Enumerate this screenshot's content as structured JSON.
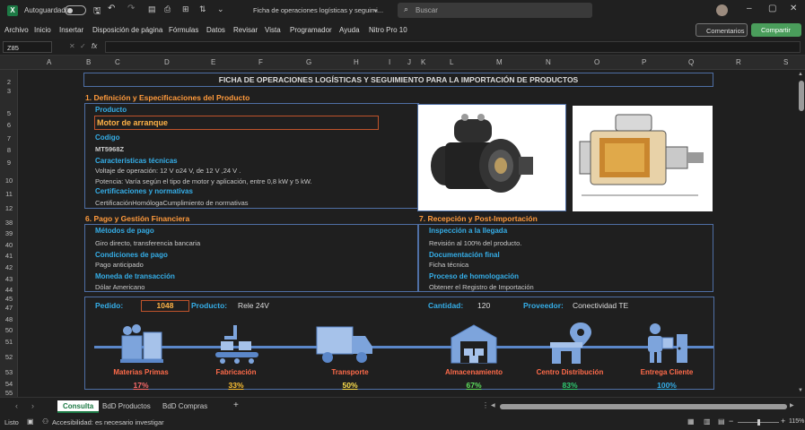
{
  "titlebar": {
    "app_icon": "excel-icon",
    "autosave_label": "Autoguardado",
    "doc_title": "Ficha de operaciones logísticas y seguimi...",
    "search_placeholder": "Buscar"
  },
  "menu": [
    "Archivo",
    "Inicio",
    "Insertar",
    "Disposición de página",
    "Fórmulas",
    "Datos",
    "Revisar",
    "Vista",
    "Programador",
    "Ayuda",
    "Nitro Pro 10"
  ],
  "comments_label": "Comentarios",
  "share_label": "Compartir",
  "formula": {
    "cell_ref": "Z85",
    "fx": "fx",
    "content": ""
  },
  "columns": [
    "A",
    "B",
    "C",
    "D",
    "E",
    "F",
    "G",
    "H",
    "I",
    "J",
    "K",
    "L",
    "M",
    "N",
    "O",
    "P",
    "Q",
    "R",
    "S"
  ],
  "rows": [
    "2",
    "3",
    "5",
    "6",
    "7",
    "8",
    "9",
    "10",
    "11",
    "12",
    "38",
    "39",
    "40",
    "41",
    "42",
    "43",
    "44",
    "45",
    "47",
    "48",
    "50",
    "51",
    "52",
    "53",
    "54",
    "55"
  ],
  "sheet": {
    "title": "FICHA DE OPERACIONES LOGÍSTICAS Y SEGUIMIENTO PARA LA IMPORTACIÓN DE PRODUCTOS",
    "s1": {
      "heading": "1. Definición y Especificaciones del Producto",
      "producto_lbl": "Producto",
      "producto_val": "Motor de arranque",
      "codigo_lbl": "Codigo",
      "codigo_val": "MT5968Z",
      "caract_lbl": "Características técnicas",
      "caract_1": "Voltaje de operación: 12 V o24 V, de 12 V ,24 V .",
      "caract_2": "Potencia: Varía según el tipo de motor y aplicación, entre 0,8 kW y 5 kW.",
      "cert_lbl": "Certificaciones y normativas",
      "cert_val": "CertificaciónHomólogaCumplimiento de normativas"
    },
    "s6": {
      "heading": "6. Pago y Gestión Financiera",
      "metodos_lbl": "Métodos de pago",
      "metodos_val": "Giro directo,  transferencia bancaria",
      "cond_lbl": "Condiciones de pago",
      "cond_val": "Pago anticipado",
      "moneda_lbl": "Moneda de transacción",
      "moneda_val": "Dólar Americano"
    },
    "s7": {
      "heading": "7. Recepción y Post-Importación",
      "insp_lbl": "Inspección a la llegada",
      "insp_val": "Revisión al 100% del producto.",
      "doc_lbl": "Documentación final",
      "doc_val": "Ficha técnica",
      "hom_lbl": "Proceso de homologación",
      "hom_val": "Obtener el Registro de Importación"
    },
    "order": {
      "pedido_lbl": "Pedido:",
      "pedido_val": "1048",
      "producto_lbl": "Producto:",
      "producto_val": "Rele 24V",
      "cantidad_lbl": "Cantidad:",
      "cantidad_val": "120",
      "proveedor_lbl": "Proveedor:",
      "proveedor_val": "Conectividad TE"
    },
    "steps": [
      {
        "name": "Materias Primas",
        "pct": "17%",
        "icon": "raw-materials-icon",
        "color": "#ff6b6b"
      },
      {
        "name": "Fabricación",
        "pct": "33%",
        "icon": "factory-conveyor-icon",
        "color": "#ffc233"
      },
      {
        "name": "Transporte",
        "pct": "50%",
        "icon": "truck-icon",
        "color": "#ffe14d"
      },
      {
        "name": "Almacenamiento",
        "pct": "67%",
        "icon": "warehouse-icon",
        "color": "#5ee05e"
      },
      {
        "name": "Centro Distribución",
        "pct": "83%",
        "icon": "store-location-icon",
        "color": "#2ecc71"
      },
      {
        "name": "Entrega Cliente",
        "pct": "100%",
        "icon": "delivery-person-icon",
        "color": "#35aee8"
      }
    ]
  },
  "tabs": [
    "Consulta",
    "BdD Productos",
    "BdD Compras"
  ],
  "status": {
    "ready": "Listo",
    "accessibility": "Accesibilidad: es necesario investigar",
    "zoom": "115%"
  }
}
